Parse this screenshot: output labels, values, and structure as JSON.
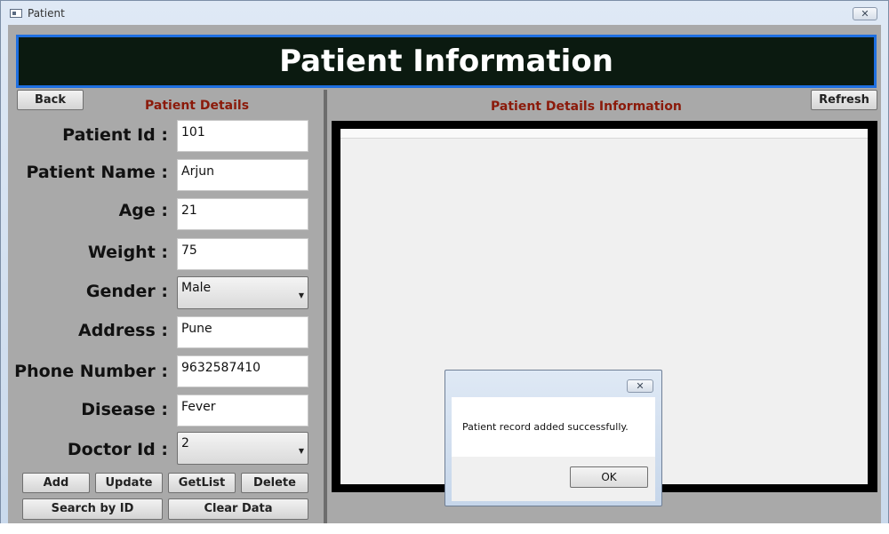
{
  "window": {
    "title": "Patient",
    "close_glyph": "✕"
  },
  "header": {
    "title": "Patient Information"
  },
  "toolbar": {
    "back_label": "Back",
    "refresh_label": "Refresh"
  },
  "left_panel": {
    "section_title": "Patient Details",
    "labels": {
      "patient_id": "Patient Id :",
      "patient_name": "Patient Name :",
      "age": "Age :",
      "weight": "Weight :",
      "gender": "Gender :",
      "address": "Address :",
      "phone": "Phone Number :",
      "disease": "Disease :",
      "doctor_id": "Doctor Id :"
    },
    "values": {
      "patient_id": "101",
      "patient_name": "Arjun",
      "age": "21",
      "weight": "75",
      "gender": "Male",
      "address": "Pune",
      "phone": "9632587410",
      "disease": "Fever",
      "doctor_id": "2"
    },
    "buttons": {
      "add": "Add",
      "update": "Update",
      "getlist": "GetList",
      "delete": "Delete",
      "search_by_id": "Search by ID",
      "clear_data": "Clear Data"
    }
  },
  "right_panel": {
    "section_title": "Patient Details Information"
  },
  "dialog": {
    "message": "Patient record added successfully.",
    "ok_label": "OK",
    "close_glyph": "✕"
  },
  "icons": {
    "dropdown": "chevron-down-icon",
    "window": "window-icon",
    "close": "close-icon"
  },
  "colors": {
    "banner_bg": "#0b1a10",
    "banner_border": "#1e6fe0",
    "section_title": "#8b1a0a",
    "panel_bg": "#a9a9a9"
  }
}
